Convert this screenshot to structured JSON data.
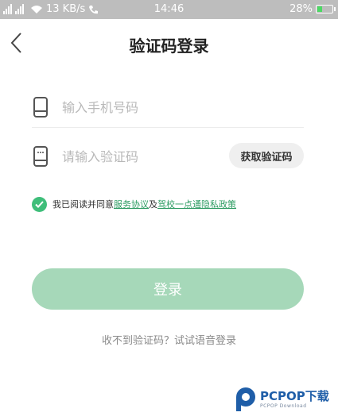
{
  "status_bar": {
    "network_speed": "13 KB/s",
    "time": "14:46",
    "battery_percent": "28%",
    "battery_level": 0.28
  },
  "header": {
    "title": "验证码登录"
  },
  "form": {
    "phone_placeholder": "输入手机号码",
    "code_placeholder": "请输入验证码",
    "get_code_label": "获取验证码"
  },
  "agreement": {
    "prefix": "我已阅读并同意",
    "service_link": "服务协议",
    "conjunction": "及",
    "privacy_link": "驾校一点通隐私政策",
    "checked": true
  },
  "login_button": "登录",
  "voice_login_text": "收不到验证码？试试语音登录",
  "watermark": {
    "title": "PCPOP下载",
    "subtitle": "PCPOP Download"
  },
  "colors": {
    "accent": "#3fbe7a",
    "login_button_bg": "#a6d8b9",
    "status_bar_bg": "#bdbdbd"
  }
}
